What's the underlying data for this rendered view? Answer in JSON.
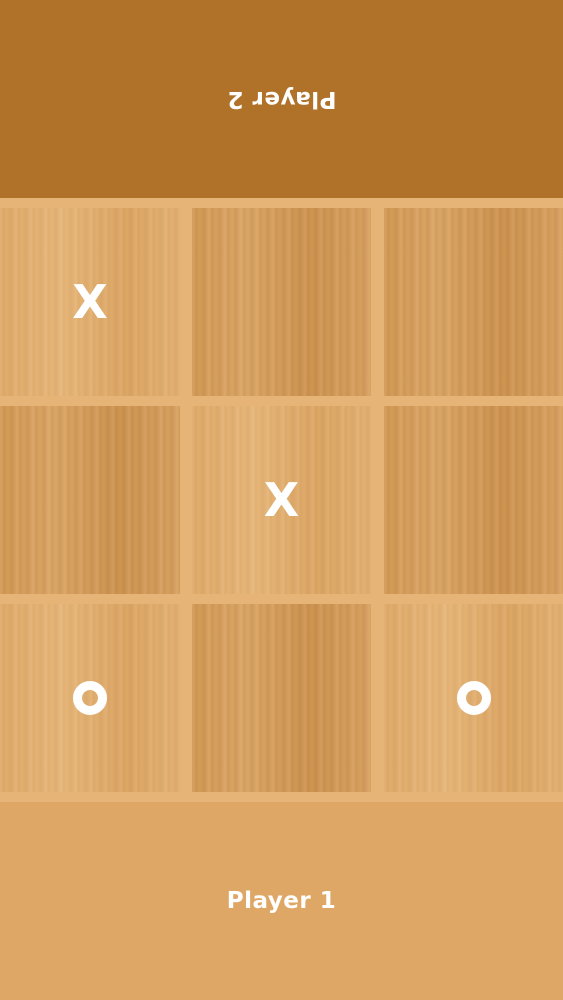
{
  "player2": {
    "label": "Player 2",
    "orientation": "upside-down",
    "bar_color": "#b07229"
  },
  "player1": {
    "label": "Player 1",
    "bar_color": "#dea766"
  },
  "board": {
    "rows": 3,
    "cols": 3,
    "cells": [
      {
        "mark": "X",
        "shade": "light"
      },
      {
        "mark": "",
        "shade": "dark"
      },
      {
        "mark": "",
        "shade": "dark"
      },
      {
        "mark": "",
        "shade": "dark"
      },
      {
        "mark": "X",
        "shade": "light"
      },
      {
        "mark": "",
        "shade": "dark"
      },
      {
        "mark": "O",
        "shade": "light"
      },
      {
        "mark": "",
        "shade": "dark"
      },
      {
        "mark": "O",
        "shade": "light"
      }
    ],
    "mark_color": "#ffffff",
    "grid_line_color": "#e6b476"
  }
}
